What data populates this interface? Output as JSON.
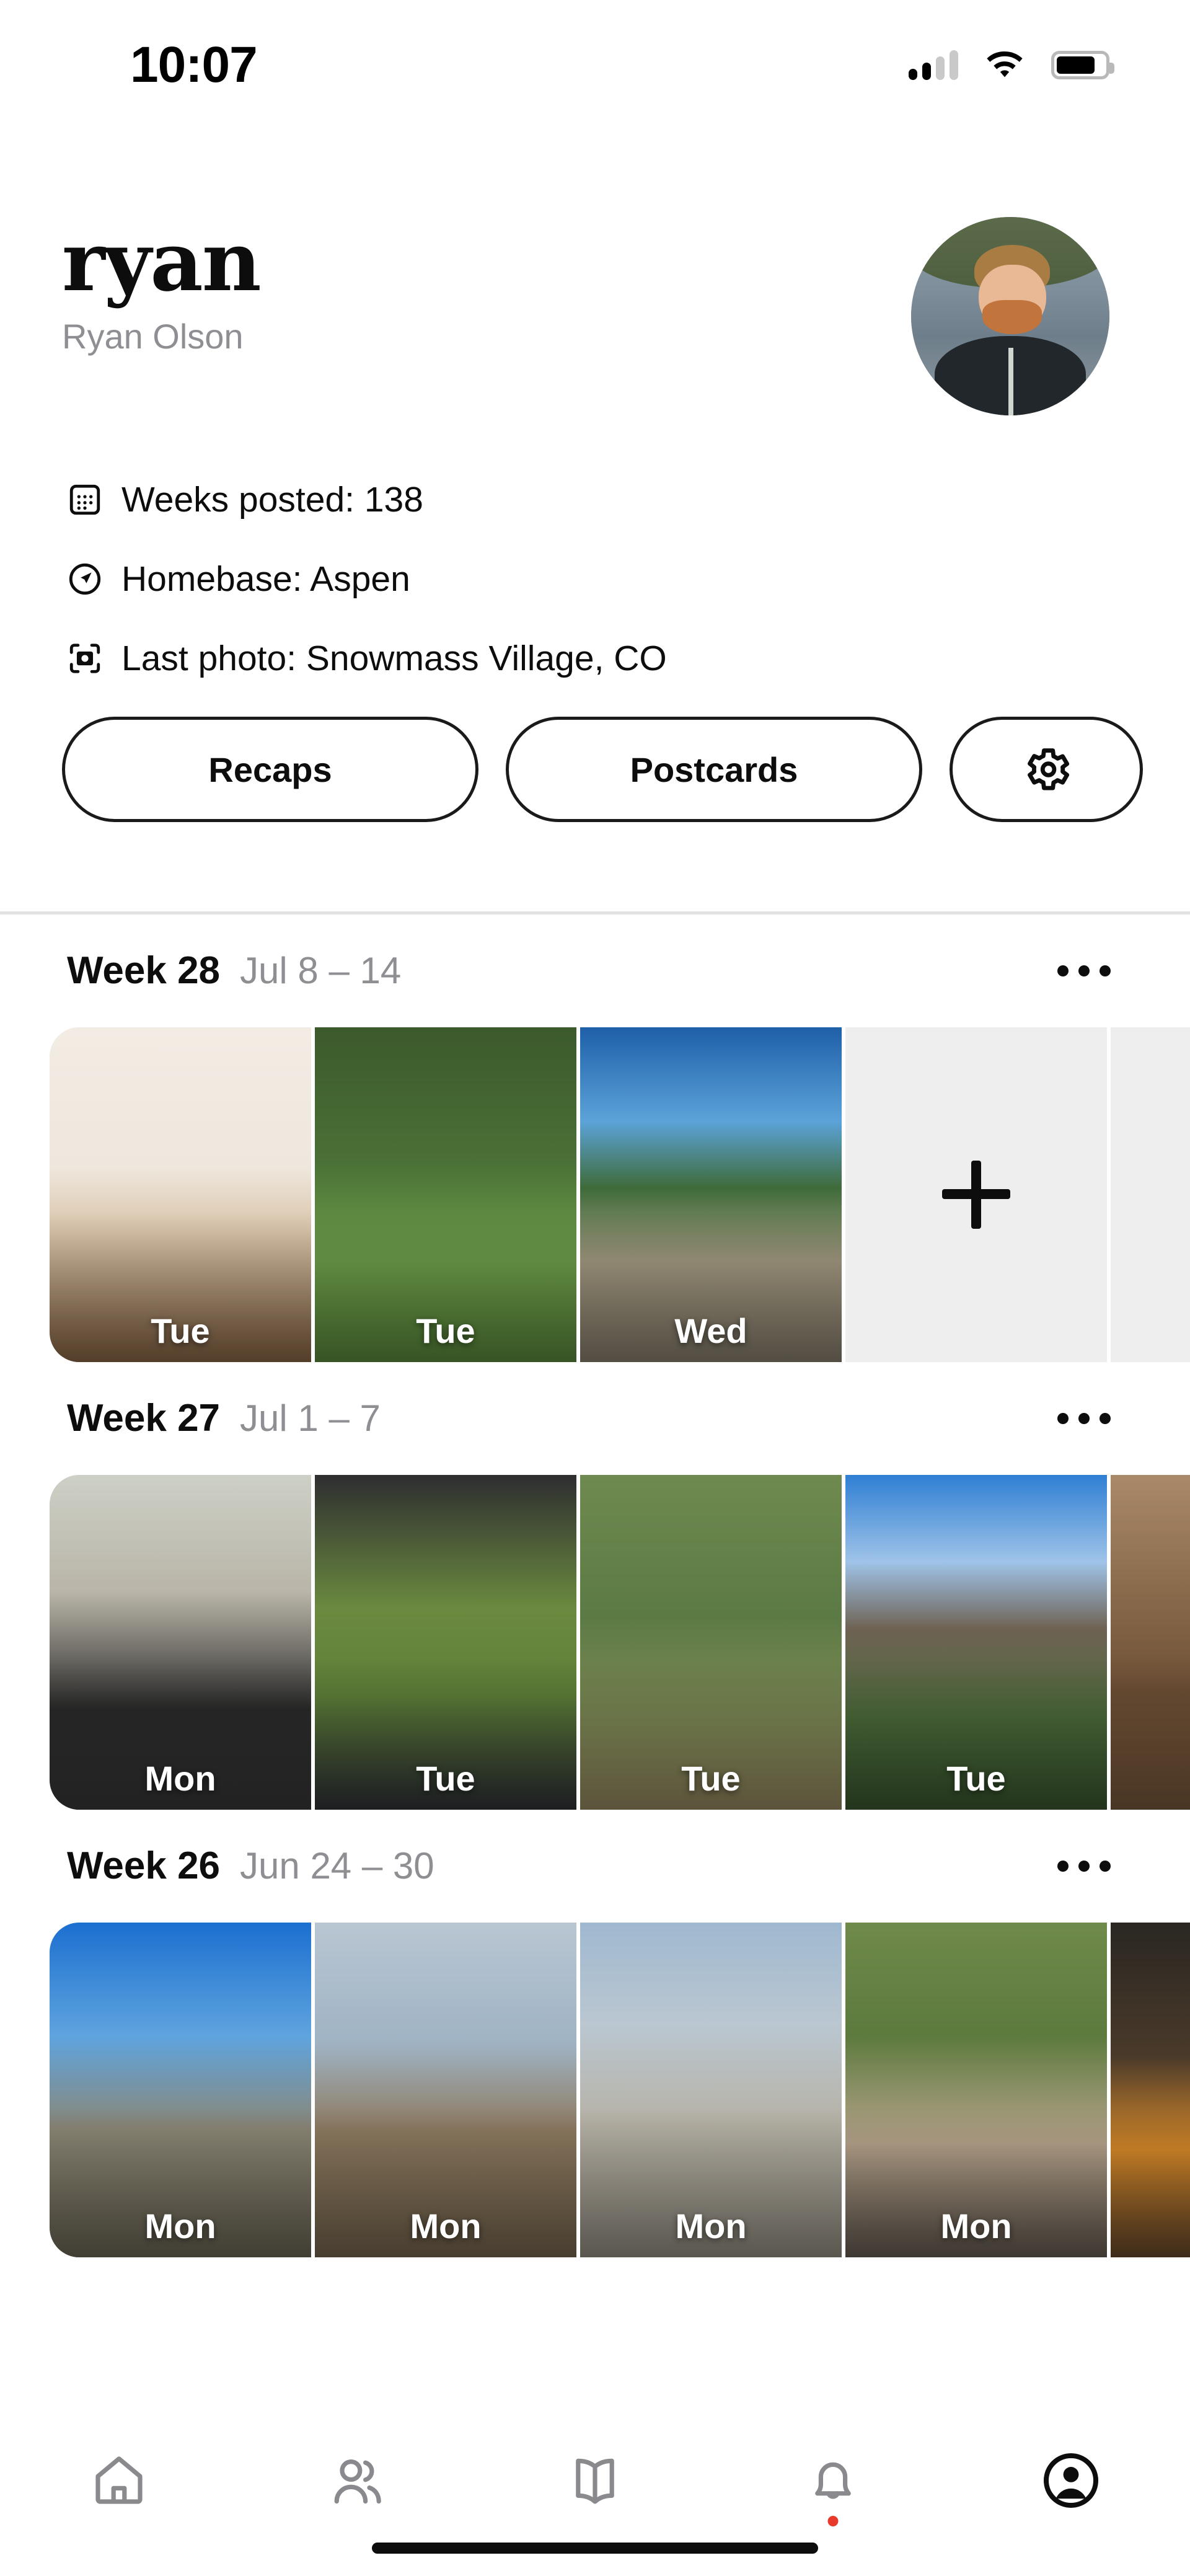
{
  "status_bar": {
    "time": "10:07",
    "signal_icon": "cellular-signal-icon",
    "signal_bars_filled": 2,
    "signal_bars_total": 4,
    "wifi_icon": "wifi-icon",
    "battery_icon": "battery-icon",
    "battery_level_pct": 80
  },
  "profile": {
    "username": "ryan",
    "full_name": "Ryan Olson",
    "avatar_name": "user-avatar",
    "info_rows": [
      {
        "icon": "calendar-icon",
        "text": "Weeks posted: 138"
      },
      {
        "icon": "navigation-arrow-icon",
        "text": "Homebase: Aspen"
      },
      {
        "icon": "camera-icon",
        "text": "Last photo: Snowmass Village, CO"
      }
    ],
    "actions": {
      "recaps_label": "Recaps",
      "postcards_label": "Postcards",
      "settings_icon": "gear-icon"
    }
  },
  "feed": {
    "more_icon": "ellipsis-icon",
    "add_icon": "plus-icon",
    "weeks": [
      {
        "title": "Week 28",
        "range": "Jul 8 – 14",
        "photos": [
          {
            "day": "Tue",
            "scene": "g1"
          },
          {
            "day": "Tue",
            "scene": "g2"
          },
          {
            "day": "Wed",
            "scene": "g3"
          }
        ],
        "has_add_tile": true,
        "has_empty_tile": true
      },
      {
        "title": "Week 27",
        "range": "Jul 1 – 7",
        "photos": [
          {
            "day": "Mon",
            "scene": "g4"
          },
          {
            "day": "Tue",
            "scene": "g5"
          },
          {
            "day": "Tue",
            "scene": "g6"
          },
          {
            "day": "Tue",
            "scene": "g7"
          },
          {
            "day": "",
            "scene": "g8"
          }
        ],
        "has_add_tile": false,
        "has_empty_tile": false
      },
      {
        "title": "Week 26",
        "range": "Jun 24 – 30",
        "photos": [
          {
            "day": "Mon",
            "scene": "g9"
          },
          {
            "day": "Mon",
            "scene": "g10"
          },
          {
            "day": "Mon",
            "scene": "g11"
          },
          {
            "day": "Mon",
            "scene": "g12"
          },
          {
            "day": "",
            "scene": "g13"
          }
        ],
        "has_add_tile": false,
        "has_empty_tile": false
      }
    ]
  },
  "bottom_nav": {
    "items": [
      {
        "name": "home",
        "icon": "home-icon",
        "active": false,
        "badge": false
      },
      {
        "name": "friends",
        "icon": "people-icon",
        "active": false,
        "badge": false
      },
      {
        "name": "book",
        "icon": "book-icon",
        "active": false,
        "badge": false
      },
      {
        "name": "notifications",
        "icon": "bell-icon",
        "active": false,
        "badge": true
      },
      {
        "name": "profile",
        "icon": "account-circle-icon",
        "active": true,
        "badge": false
      }
    ],
    "badge_color": "#e8392a",
    "active_color": "#0d0d0d",
    "inactive_color": "#8a8a8e"
  }
}
